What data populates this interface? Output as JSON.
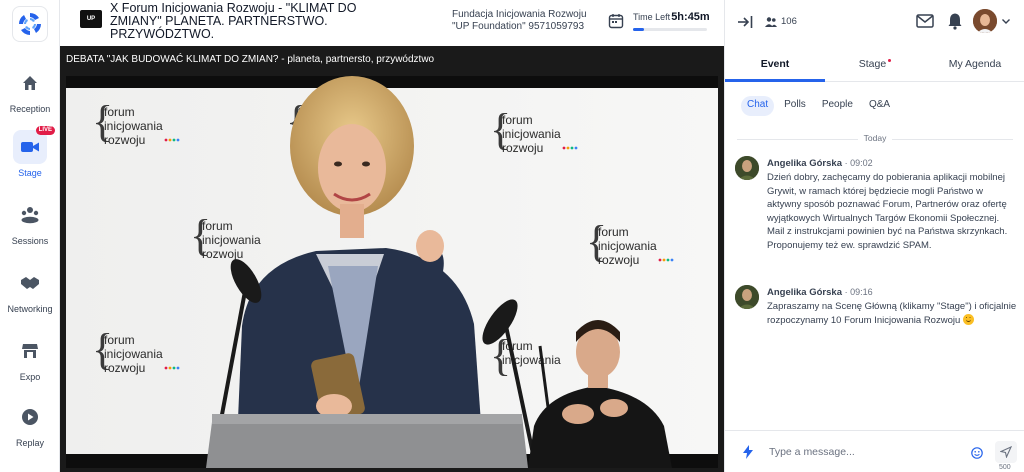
{
  "sidebar": {
    "items": [
      {
        "label": "Reception",
        "icon": "home-icon"
      },
      {
        "label": "Stage",
        "icon": "video-camera-icon",
        "badge": "LIVE",
        "active": true
      },
      {
        "label": "Sessions",
        "icon": "sessions-icon"
      },
      {
        "label": "Networking",
        "icon": "handshake-icon"
      },
      {
        "label": "Expo",
        "icon": "booth-icon"
      },
      {
        "label": "Replay",
        "icon": "play-circle-icon"
      }
    ]
  },
  "header": {
    "logo_text": "UP",
    "title": "X Forum Inicjowania Rozwoju - \"KLIMAT DO ZMIANY\" PLANETA. PARTNERSTWO. PRZYWÓDZTWO.",
    "organizer": "Fundacja Inicjowania Rozwoju \"UP Foundation\" 9571059793",
    "time_left_label": "Time Left",
    "time_left_value": "5h:45m",
    "time_left_progress": 0.15
  },
  "stage": {
    "session_title": "DEBATA \"JAK BUDOWAĆ KLIMAT DO ZMIAN? - planeta, partnersto, przywództwo",
    "backdrop_logo_lines": [
      "forum",
      "inicjowania",
      "rozwoju"
    ]
  },
  "panel": {
    "attendee_count": "106",
    "tabs": [
      {
        "label": "Event",
        "active": true
      },
      {
        "label": "Stage",
        "dot": true
      },
      {
        "label": "My Agenda"
      }
    ],
    "subtabs": [
      {
        "label": "Chat",
        "active": true
      },
      {
        "label": "Polls"
      },
      {
        "label": "People"
      },
      {
        "label": "Q&A"
      }
    ],
    "day_divider": "Today",
    "messages": [
      {
        "author": "Angelika Górska",
        "time": "· 09:02",
        "text": "Dzień dobry, zachęcamy do pobierania aplikacji mobilnej Grywit, w ramach której będziecie mogli Państwo w aktywny sposób poznawać Forum, Partnerów oraz ofertę wyjątkowych Wirtualnych Targów Ekonomii Społecznej. Mail z instrukcjami powinien być na Państwa skrzynkach. Proponujemy też ew. sprawdzić SPAM."
      },
      {
        "author": "Angelika Górska",
        "time": "· 09:16",
        "text": "Zapraszamy na Scenę Główną (klikamy \"Stage\") i oficjalnie rozpoczynamy 10 Forum Inicjowania Rozwoju",
        "emoji": "smile-icon"
      }
    ],
    "composer": {
      "placeholder": "Type a message...",
      "char_limit": "500"
    }
  },
  "colors": {
    "accent": "#2563eb",
    "live": "#e11d48",
    "stage_bg": "#1a1a1a"
  }
}
